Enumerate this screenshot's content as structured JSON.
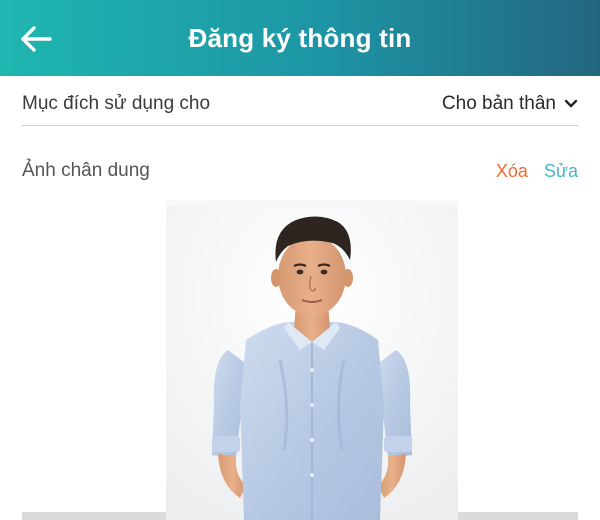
{
  "header": {
    "title": "Đăng ký thông tin",
    "back_icon": "arrow-left-icon",
    "gradient": [
      "#1fb6b0",
      "#23667f"
    ]
  },
  "purpose": {
    "label": "Mục đích sử dụng cho",
    "value": "Cho bản thân",
    "dropdown_icon": "chevron-down-icon"
  },
  "portrait": {
    "label": "Ảnh chân dung",
    "delete_label": "Xóa",
    "edit_label": "Sửa",
    "delete_color": "#f26a2e",
    "edit_color": "#46b8c8"
  }
}
